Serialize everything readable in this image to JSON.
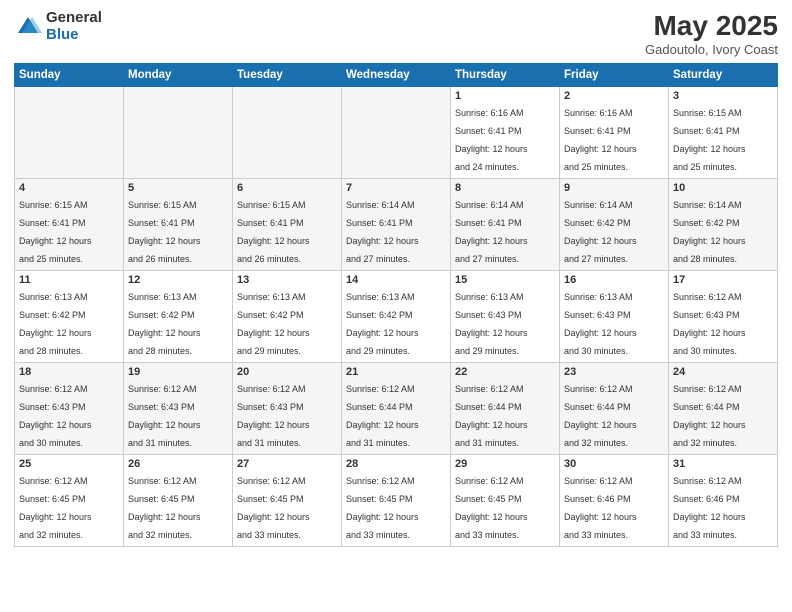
{
  "header": {
    "logo_general": "General",
    "logo_blue": "Blue",
    "title": "May 2025",
    "subtitle": "Gadoutolo, Ivory Coast"
  },
  "calendar": {
    "weekdays": [
      "Sunday",
      "Monday",
      "Tuesday",
      "Wednesday",
      "Thursday",
      "Friday",
      "Saturday"
    ],
    "weeks": [
      [
        {
          "day": "",
          "info": ""
        },
        {
          "day": "",
          "info": ""
        },
        {
          "day": "",
          "info": ""
        },
        {
          "day": "",
          "info": ""
        },
        {
          "day": "1",
          "info": "Sunrise: 6:16 AM\nSunset: 6:41 PM\nDaylight: 12 hours\nand 24 minutes."
        },
        {
          "day": "2",
          "info": "Sunrise: 6:16 AM\nSunset: 6:41 PM\nDaylight: 12 hours\nand 25 minutes."
        },
        {
          "day": "3",
          "info": "Sunrise: 6:15 AM\nSunset: 6:41 PM\nDaylight: 12 hours\nand 25 minutes."
        }
      ],
      [
        {
          "day": "4",
          "info": "Sunrise: 6:15 AM\nSunset: 6:41 PM\nDaylight: 12 hours\nand 25 minutes."
        },
        {
          "day": "5",
          "info": "Sunrise: 6:15 AM\nSunset: 6:41 PM\nDaylight: 12 hours\nand 26 minutes."
        },
        {
          "day": "6",
          "info": "Sunrise: 6:15 AM\nSunset: 6:41 PM\nDaylight: 12 hours\nand 26 minutes."
        },
        {
          "day": "7",
          "info": "Sunrise: 6:14 AM\nSunset: 6:41 PM\nDaylight: 12 hours\nand 27 minutes."
        },
        {
          "day": "8",
          "info": "Sunrise: 6:14 AM\nSunset: 6:41 PM\nDaylight: 12 hours\nand 27 minutes."
        },
        {
          "day": "9",
          "info": "Sunrise: 6:14 AM\nSunset: 6:42 PM\nDaylight: 12 hours\nand 27 minutes."
        },
        {
          "day": "10",
          "info": "Sunrise: 6:14 AM\nSunset: 6:42 PM\nDaylight: 12 hours\nand 28 minutes."
        }
      ],
      [
        {
          "day": "11",
          "info": "Sunrise: 6:13 AM\nSunset: 6:42 PM\nDaylight: 12 hours\nand 28 minutes."
        },
        {
          "day": "12",
          "info": "Sunrise: 6:13 AM\nSunset: 6:42 PM\nDaylight: 12 hours\nand 28 minutes."
        },
        {
          "day": "13",
          "info": "Sunrise: 6:13 AM\nSunset: 6:42 PM\nDaylight: 12 hours\nand 29 minutes."
        },
        {
          "day": "14",
          "info": "Sunrise: 6:13 AM\nSunset: 6:42 PM\nDaylight: 12 hours\nand 29 minutes."
        },
        {
          "day": "15",
          "info": "Sunrise: 6:13 AM\nSunset: 6:43 PM\nDaylight: 12 hours\nand 29 minutes."
        },
        {
          "day": "16",
          "info": "Sunrise: 6:13 AM\nSunset: 6:43 PM\nDaylight: 12 hours\nand 30 minutes."
        },
        {
          "day": "17",
          "info": "Sunrise: 6:12 AM\nSunset: 6:43 PM\nDaylight: 12 hours\nand 30 minutes."
        }
      ],
      [
        {
          "day": "18",
          "info": "Sunrise: 6:12 AM\nSunset: 6:43 PM\nDaylight: 12 hours\nand 30 minutes."
        },
        {
          "day": "19",
          "info": "Sunrise: 6:12 AM\nSunset: 6:43 PM\nDaylight: 12 hours\nand 31 minutes."
        },
        {
          "day": "20",
          "info": "Sunrise: 6:12 AM\nSunset: 6:43 PM\nDaylight: 12 hours\nand 31 minutes."
        },
        {
          "day": "21",
          "info": "Sunrise: 6:12 AM\nSunset: 6:44 PM\nDaylight: 12 hours\nand 31 minutes."
        },
        {
          "day": "22",
          "info": "Sunrise: 6:12 AM\nSunset: 6:44 PM\nDaylight: 12 hours\nand 31 minutes."
        },
        {
          "day": "23",
          "info": "Sunrise: 6:12 AM\nSunset: 6:44 PM\nDaylight: 12 hours\nand 32 minutes."
        },
        {
          "day": "24",
          "info": "Sunrise: 6:12 AM\nSunset: 6:44 PM\nDaylight: 12 hours\nand 32 minutes."
        }
      ],
      [
        {
          "day": "25",
          "info": "Sunrise: 6:12 AM\nSunset: 6:45 PM\nDaylight: 12 hours\nand 32 minutes."
        },
        {
          "day": "26",
          "info": "Sunrise: 6:12 AM\nSunset: 6:45 PM\nDaylight: 12 hours\nand 32 minutes."
        },
        {
          "day": "27",
          "info": "Sunrise: 6:12 AM\nSunset: 6:45 PM\nDaylight: 12 hours\nand 33 minutes."
        },
        {
          "day": "28",
          "info": "Sunrise: 6:12 AM\nSunset: 6:45 PM\nDaylight: 12 hours\nand 33 minutes."
        },
        {
          "day": "29",
          "info": "Sunrise: 6:12 AM\nSunset: 6:45 PM\nDaylight: 12 hours\nand 33 minutes."
        },
        {
          "day": "30",
          "info": "Sunrise: 6:12 AM\nSunset: 6:46 PM\nDaylight: 12 hours\nand 33 minutes."
        },
        {
          "day": "31",
          "info": "Sunrise: 6:12 AM\nSunset: 6:46 PM\nDaylight: 12 hours\nand 33 minutes."
        }
      ]
    ]
  }
}
